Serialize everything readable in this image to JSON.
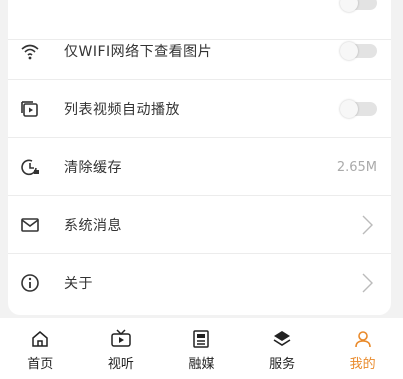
{
  "settings": {
    "items": [
      {
        "label": "",
        "icon": "unknown-icon",
        "control": "toggle"
      },
      {
        "label": "仅WIFI网络下查看图片",
        "icon": "wifi-icon",
        "control": "toggle",
        "toggle_on": false
      },
      {
        "label": "列表视频自动播放",
        "icon": "video-play-icon",
        "control": "toggle",
        "toggle_on": false
      },
      {
        "label": "清除缓存",
        "icon": "clock-clear-icon",
        "control": "value",
        "value": "2.65M"
      },
      {
        "label": "系统消息",
        "icon": "mail-icon",
        "control": "chevron"
      },
      {
        "label": "关于",
        "icon": "info-icon",
        "control": "chevron"
      }
    ]
  },
  "tabbar": {
    "tabs": [
      {
        "label": "首页",
        "icon": "home-icon"
      },
      {
        "label": "视听",
        "icon": "tv-icon"
      },
      {
        "label": "融媒",
        "icon": "news-icon"
      },
      {
        "label": "服务",
        "icon": "layers-icon"
      },
      {
        "label": "我的",
        "icon": "user-icon",
        "active": true
      }
    ],
    "active_color": "#e98a2b"
  }
}
